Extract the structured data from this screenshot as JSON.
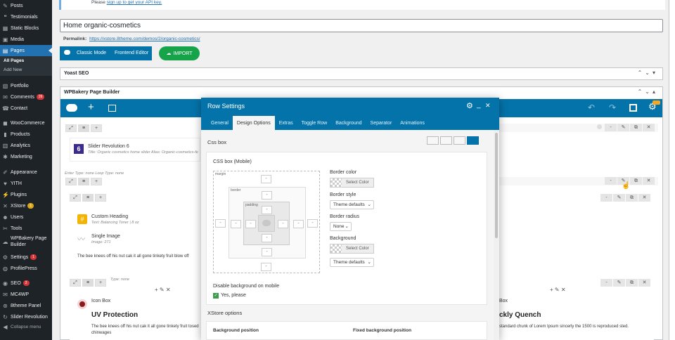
{
  "sidebar": {
    "items": [
      {
        "label": "Posts",
        "icon": "pin-icon"
      },
      {
        "label": "Testimonials",
        "icon": "quote-icon"
      },
      {
        "label": "Static Blocks",
        "icon": "block-icon"
      },
      {
        "label": "Media",
        "icon": "media-icon"
      },
      {
        "label": "Pages",
        "icon": "pages-icon"
      },
      {
        "label": "Portfolio",
        "icon": "portfolio-icon"
      },
      {
        "label": "Comments",
        "icon": "comment-icon",
        "badge": "26"
      },
      {
        "label": "Contact",
        "icon": "contact-icon"
      },
      {
        "label": "WooCommerce",
        "icon": "woo-icon"
      },
      {
        "label": "Products",
        "icon": "products-icon"
      },
      {
        "label": "Analytics",
        "icon": "analytics-icon"
      },
      {
        "label": "Marketing",
        "icon": "marketing-icon"
      },
      {
        "label": "Appearance",
        "icon": "appearance-icon"
      },
      {
        "label": "YITH",
        "icon": "yith-icon"
      },
      {
        "label": "Plugins",
        "icon": "plugins-icon"
      },
      {
        "label": "XStore",
        "icon": "xstore-icon",
        "badge": "1"
      },
      {
        "label": "Users",
        "icon": "users-icon"
      },
      {
        "label": "Tools",
        "icon": "tools-icon"
      },
      {
        "label": "WPBakery Page Builder",
        "icon": "wpbakery-icon"
      },
      {
        "label": "Settings",
        "icon": "settings-icon",
        "badge": "1"
      },
      {
        "label": "ProfilePress",
        "icon": "profilepress-icon"
      },
      {
        "label": "SEO",
        "icon": "seo-icon",
        "badge": "2"
      },
      {
        "label": "MC4WP",
        "icon": "mc4wp-icon"
      },
      {
        "label": "8theme Panel",
        "icon": "panel-icon"
      },
      {
        "label": "Slider Revolution",
        "icon": "slider-icon"
      }
    ],
    "submenu": [
      "All Pages",
      "Add New"
    ],
    "collapse": "Collapse menu"
  },
  "notice": {
    "prefix": "Please ",
    "link": "sign up to get your API key."
  },
  "title_value": "Home organic-cosmetics",
  "permalink": {
    "label": "Permalink:",
    "url": "https://xstore.8theme.com/demos/2/organic-cosmetics/"
  },
  "buttons": {
    "classic": "Classic Mode",
    "frontend": "Frontend Editor",
    "import": "IMPORT"
  },
  "yoast": "Yoast SEO",
  "wpbakery": "WPBakery Page Builder",
  "builder": {
    "slider_title": "Slider Revolution 6",
    "slider_sub": "Title: Organic cosmetics home slider  Alias: Organic-cosmetics-fe",
    "row_meta": "Enter Type: none  Loop Type: none",
    "custom_heading": "Custom Heading",
    "custom_heading_sub": "Text: Balancing Toner | 8 oz",
    "single_image": "Single Image",
    "single_image_sub": "Image: 271",
    "text_block": "The bee knees off his nut cak it all gone tinkety fruit blow off",
    "type_none": "Type: none",
    "icon_box": "Icon Box",
    "uv_title": "UV Protection",
    "uv_text": "The bee knees off his nut cak it all gone tinkety fruit tosed chinwages",
    "right_icon_box": "Box",
    "quench_title": "ckly Quench",
    "quench_text": "standard chunk of Lorem Ipsum sincerly the 1500 is reproduced sted."
  },
  "modal": {
    "title": "Row Settings",
    "tabs": [
      "General",
      "Design Options",
      "Extras",
      "Toggle Row",
      "Background",
      "Separator",
      "Animations"
    ],
    "active_tab": "Design Options",
    "css_box": "Css box",
    "css_box_mobile": "CSS box (Mobile)",
    "margin": "margin",
    "border": "border",
    "padding": "padding",
    "dash": "-",
    "border_color": "Border color",
    "select_color": "Select Color",
    "border_style": "Border style",
    "border_style_value": "Theme defaults",
    "border_radius": "Border radius",
    "border_radius_value": "None",
    "background": "Background",
    "background_value": "Theme defaults",
    "disable_bg": "Disable background on mobile",
    "disable_bg_check": "Yes, please",
    "xstore_options": "XStore options",
    "bg_position": "Background position",
    "fixed_bg_position": "Fixed background position"
  },
  "colors": {
    "accent": "#2271b1",
    "wpb_blue": "#0473aa",
    "import_green": "#16a34a",
    "sidebar": "#1d2327"
  }
}
